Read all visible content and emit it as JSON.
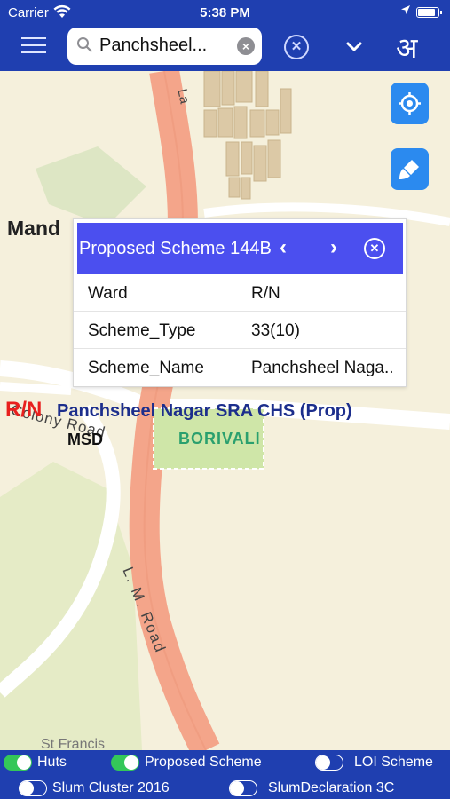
{
  "status_bar": {
    "carrier": "Carrier",
    "time": "5:38 PM"
  },
  "nav": {
    "search_value": "Panchsheel...",
    "language_glyph": "अ"
  },
  "map": {
    "labels": {
      "area_mand": "Mand",
      "road_colony": "Colony Road",
      "ward": "R/N",
      "scheme_name": "Panchsheel Nagar SRA CHS (Prop)",
      "msd": "MSD",
      "borivali": "BORIVALI",
      "road_lm": "L. M. Road",
      "road_la": "La",
      "st_francis": "St Francis"
    }
  },
  "popup": {
    "title": "Proposed Scheme 144B",
    "rows": [
      {
        "key": "Ward",
        "value": "R/N"
      },
      {
        "key": "Scheme_Type",
        "value": "33(10)"
      },
      {
        "key": "Scheme_Name",
        "value": "Panchsheel Naga.."
      }
    ]
  },
  "layers": [
    {
      "label": "Huts",
      "on": true
    },
    {
      "label": "Proposed Scheme",
      "on": true
    },
    {
      "label": "LOI Scheme",
      "on": false
    },
    {
      "label": "Slum Cluster 2016",
      "on": false
    },
    {
      "label": "SlumDeclaration 3C",
      "on": false
    }
  ],
  "colors": {
    "nav_blue": "#1f3fb0",
    "popup_header": "#4b4fef",
    "fab_blue": "#2b8aef",
    "toggle_on": "#34c759",
    "ward_red": "#e8201e",
    "scheme_blue": "#1c2e8c",
    "borivali_teal": "#2aa06e"
  }
}
